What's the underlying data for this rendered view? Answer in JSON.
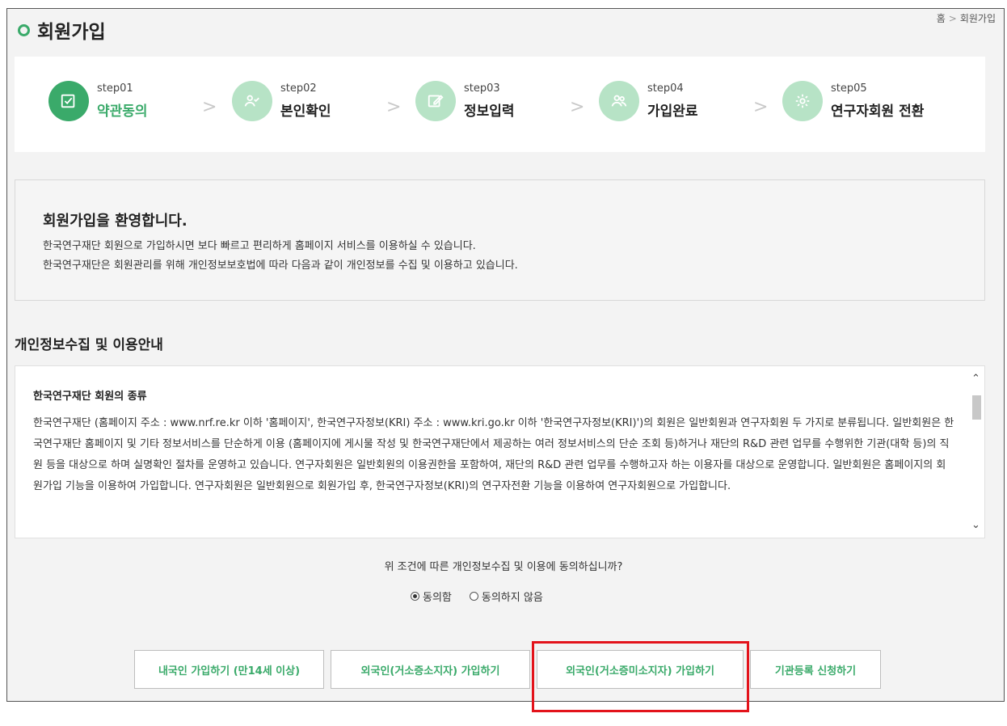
{
  "page": {
    "title": "회원가입",
    "breadcrumb": [
      "홈",
      "회원가입"
    ]
  },
  "steps": [
    {
      "num": "step01",
      "name": "약관동의",
      "icon": "check-square-icon",
      "active": true
    },
    {
      "num": "step02",
      "name": "본인확인",
      "icon": "user-check-icon",
      "active": false
    },
    {
      "num": "step03",
      "name": "정보입력",
      "icon": "edit-icon",
      "active": false
    },
    {
      "num": "step04",
      "name": "가입완료",
      "icon": "users-icon",
      "active": false
    },
    {
      "num": "step05",
      "name": "연구자회원 전환",
      "icon": "gear-icon",
      "active": false
    }
  ],
  "welcome": {
    "heading": "회원가입을 환영합니다.",
    "line1": "한국연구재단 회원으로 가입하시면 보다 빠르고 편리하게 홈페이지 서비스를 이용하실 수 있습니다.",
    "line2": "한국연구재단은 회원관리를 위해 개인정보보호법에 따라 다음과 같이 개인정보를 수집 및 이용하고 있습니다."
  },
  "privacy": {
    "section_title": "개인정보수집 및 이용안내",
    "terms_heading": "한국연구재단 회원의 종류",
    "terms_body": "한국연구재단 (홈페이지 주소 : www.nrf.re.kr 이하 '홈페이지', 한국연구자정보(KRI) 주소 : www.kri.go.kr 이하 '한국연구자정보(KRI)')의 회원은 일반회원과 연구자회원 두 가지로 분류됩니다. 일반회원은 한국연구재단 홈페이지 및 기타 정보서비스를 단순하게 이용 (홈페이지에 게시물 작성 및 한국연구재단에서 제공하는 여러 정보서비스의 단순 조회 등)하거나 재단의 R&D 관련 업무를 수행위한 기관(대학 등)의 직원 등을 대상으로 하며 실명확인 절차를 운영하고 있습니다. 연구자회원은 일반회원의 이용권한을 포함하여, 재단의 R&D 관련 업무를 수행하고자 하는 이용자를 대상으로 운영합니다. 일반회원은 홈페이지의 회원가입 기능을 이용하여 가입합니다. 연구자회원은 일반회원으로 회원가입 후, 한국연구자정보(KRI)의 연구자전환 기능을 이용하여 연구자회원으로 가입합니다.",
    "question": "위 조건에 따른 개인정보수집 및 이용에 동의하십니까?",
    "agree_label": "동의함",
    "disagree_label": "동의하지 않음",
    "agree_selected": true
  },
  "buttons": {
    "domestic": "내국인 가입하기 (만14세 이상)",
    "foreign_with_id": "외국인(거소증소지자) 가입하기",
    "foreign_without_id": "외국인(거소증미소지자) 가입하기",
    "institution": "기관등록 신청하기"
  },
  "colors": {
    "accent": "#3aaa6a",
    "accent_light": "#b7e3c6",
    "highlight": "#e3131b"
  }
}
